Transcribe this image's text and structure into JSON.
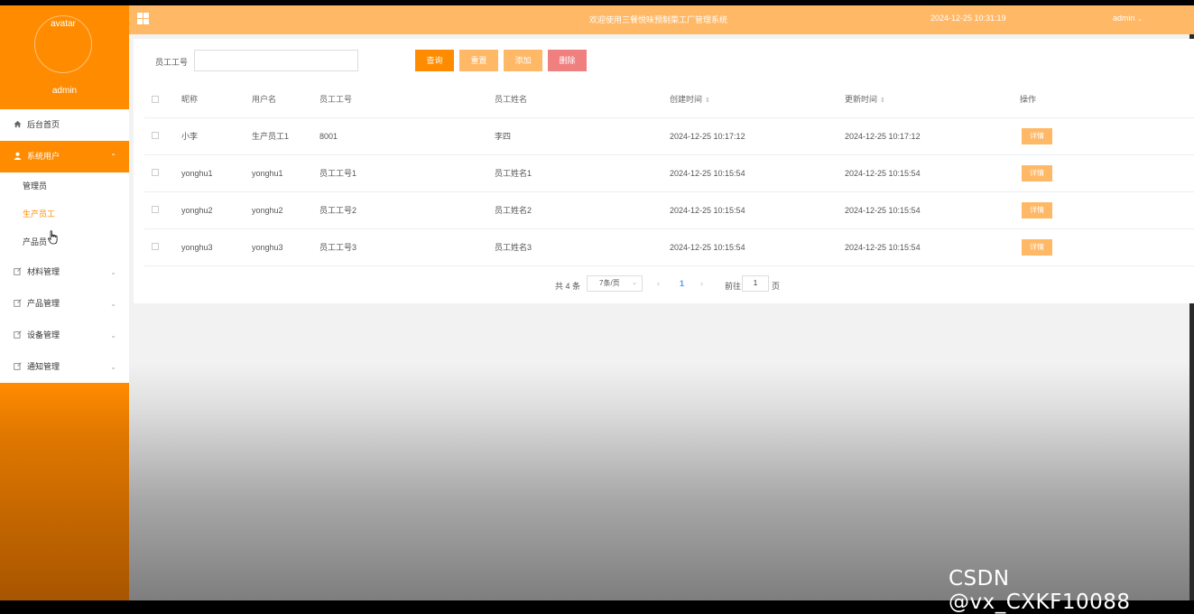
{
  "sidebar": {
    "avatar_alt": "avatar",
    "username": "admin",
    "menu": [
      {
        "label": "后台首页",
        "icon": "home-icon"
      },
      {
        "label": "系统用户",
        "icon": "user-icon",
        "active": true,
        "children": [
          "管理员",
          "生产员工",
          "产品员"
        ]
      },
      {
        "label": "材料管理",
        "icon": "edit-icon"
      },
      {
        "label": "产品管理",
        "icon": "edit-icon"
      },
      {
        "label": "设备管理",
        "icon": "edit-icon"
      },
      {
        "label": "通知管理",
        "icon": "edit-icon"
      }
    ],
    "current_sub": "生产员工"
  },
  "header": {
    "welcome": "欢迎使用三餐悦味预制菜工厂管理系统",
    "datetime": "2024-12-25 10:31:19",
    "user": "admin"
  },
  "search": {
    "label": "员工工号",
    "value": "",
    "buttons": {
      "query": "查询",
      "reset": "重置",
      "add": "添加",
      "delete": "删除"
    }
  },
  "table": {
    "columns": [
      "昵称",
      "用户名",
      "员工工号",
      "员工姓名",
      "创建时间",
      "更新时间",
      "操作"
    ],
    "rows": [
      {
        "nickname": "小李",
        "username": "生产员工1",
        "emp_no": "8001",
        "emp_name": "李四",
        "created": "2024-12-25 10:17:12",
        "updated": "2024-12-25 10:17:12",
        "action": "详情"
      },
      {
        "nickname": "yonghu1",
        "username": "yonghu1",
        "emp_no": "员工工号1",
        "emp_name": "员工姓名1",
        "created": "2024-12-25 10:15:54",
        "updated": "2024-12-25 10:15:54",
        "action": "详情"
      },
      {
        "nickname": "yonghu2",
        "username": "yonghu2",
        "emp_no": "员工工号2",
        "emp_name": "员工姓名2",
        "created": "2024-12-25 10:15:54",
        "updated": "2024-12-25 10:15:54",
        "action": "详情"
      },
      {
        "nickname": "yonghu3",
        "username": "yonghu3",
        "emp_no": "员工工号3",
        "emp_name": "员工姓名3",
        "created": "2024-12-25 10:15:54",
        "updated": "2024-12-25 10:15:54",
        "action": "详情"
      }
    ]
  },
  "pagination": {
    "total": "共 4 条",
    "page_size": "7条/页",
    "current_page": "1",
    "goto_label": "前往",
    "goto_value": "1",
    "page_suffix": "页"
  },
  "watermark": "CSDN @vx_CXKF10088",
  "colors": {
    "primary": "#ff8c00",
    "light": "#ffb866",
    "danger": "#f08080",
    "link": "#409eff"
  }
}
